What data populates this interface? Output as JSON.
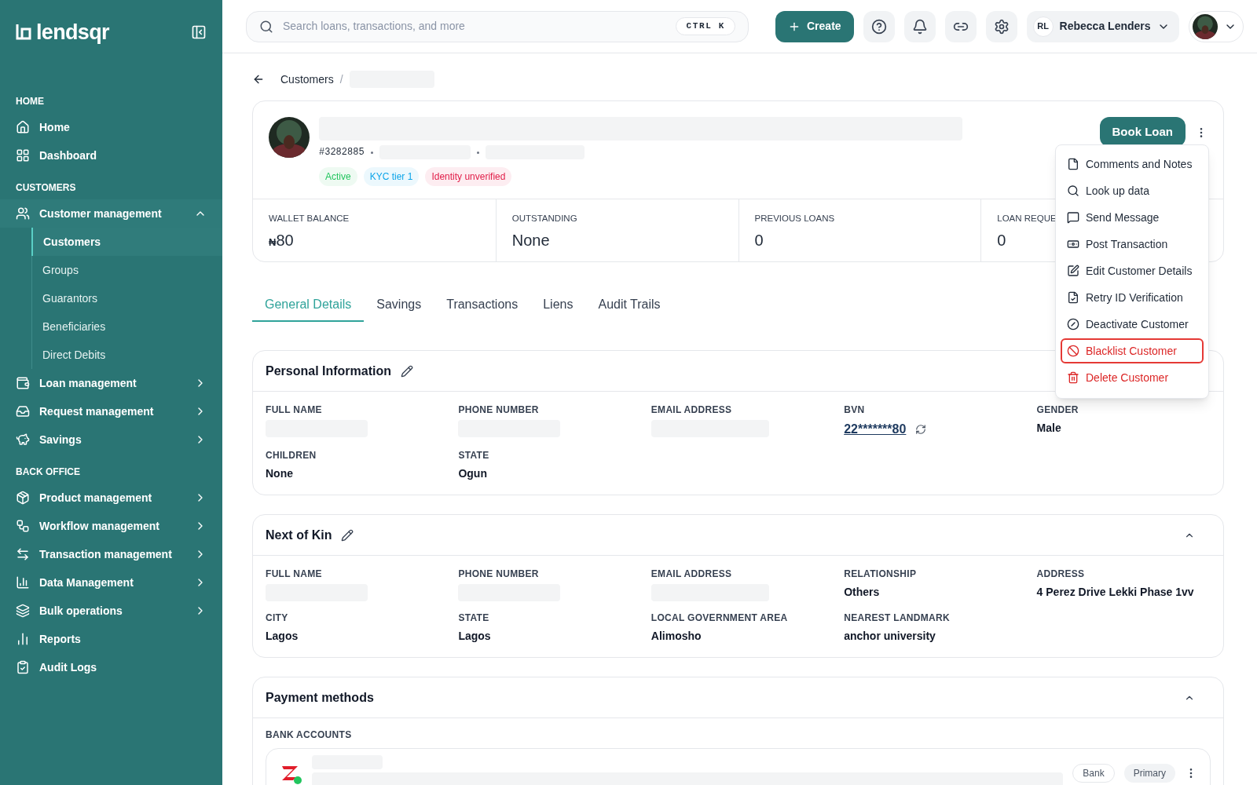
{
  "brand": {
    "name": "lendsqr"
  },
  "sidebar": {
    "sections": [
      {
        "title": "HOME",
        "items": [
          {
            "label": "Home",
            "kind": "link",
            "selected": false
          },
          {
            "label": "Dashboard",
            "kind": "link",
            "selected": false
          }
        ]
      },
      {
        "title": "CUSTOMERS",
        "items": [
          {
            "label": "Customer management",
            "kind": "group",
            "expanded": true,
            "selected": false,
            "children": [
              {
                "label": "Customers",
                "selected": true
              },
              {
                "label": "Groups",
                "selected": false
              },
              {
                "label": "Guarantors",
                "selected": false
              },
              {
                "label": "Beneficiaries",
                "selected": false
              },
              {
                "label": "Direct Debits",
                "selected": false
              }
            ]
          },
          {
            "label": "Loan management",
            "kind": "group",
            "expanded": false,
            "selected": false
          },
          {
            "label": "Request management",
            "kind": "group",
            "expanded": false,
            "selected": false
          },
          {
            "label": "Savings",
            "kind": "group",
            "expanded": false,
            "selected": false
          }
        ]
      },
      {
        "title": "BACK OFFICE",
        "items": [
          {
            "label": "Product management",
            "kind": "group",
            "expanded": false,
            "selected": false
          },
          {
            "label": "Workflow management",
            "kind": "group",
            "expanded": false,
            "selected": false
          },
          {
            "label": "Transaction management",
            "kind": "group",
            "expanded": false,
            "selected": false
          },
          {
            "label": "Data Management",
            "kind": "group",
            "expanded": false,
            "selected": false
          },
          {
            "label": "Bulk operations",
            "kind": "group",
            "expanded": false,
            "selected": false
          },
          {
            "label": "Reports",
            "kind": "link",
            "selected": false
          },
          {
            "label": "Audit Logs",
            "kind": "link",
            "selected": false
          }
        ]
      }
    ]
  },
  "header": {
    "search": {
      "placeholder": "Search loans, transactions, and more",
      "shortcut": "CTRL K"
    },
    "create_button": "Create",
    "user": {
      "initials": "RL",
      "name": "Rebecca Lenders"
    }
  },
  "breadcrumb": [
    "Customers",
    "/"
  ],
  "profile": {
    "customer_id": "#3282885",
    "badges": [
      {
        "label": "Active",
        "color": "#22c55e"
      },
      {
        "label": "KYC tier 1",
        "color": "#0ea5e9"
      },
      {
        "label": "Identity unverified",
        "color": "#e11d48"
      }
    ],
    "book_loan": "Book Loan"
  },
  "stats": [
    {
      "label": "WALLET BALANCE",
      "currency": "₦",
      "value": "80"
    },
    {
      "label": "OUTSTANDING",
      "value": "None"
    },
    {
      "label": "PREVIOUS LOANS",
      "value": "0"
    },
    {
      "label": "LOAN REQUE",
      "value": "0"
    }
  ],
  "menu": [
    {
      "label": "Comments and Notes",
      "kind": "normal",
      "selected": false
    },
    {
      "label": "Look up data",
      "kind": "normal",
      "selected": false
    },
    {
      "label": "Send Message",
      "kind": "normal",
      "selected": false
    },
    {
      "label": "Post Transaction",
      "kind": "normal",
      "selected": false
    },
    {
      "label": "Edit Customer Details",
      "kind": "normal",
      "selected": false
    },
    {
      "label": "Retry ID Verification",
      "kind": "normal",
      "selected": false
    },
    {
      "label": "Deactivate Customer",
      "kind": "normal",
      "selected": false
    },
    {
      "label": "Blacklist Customer",
      "kind": "danger",
      "selected": true
    },
    {
      "label": "Delete Customer",
      "kind": "danger",
      "selected": false
    }
  ],
  "tabs": [
    {
      "label": "General Details",
      "selected": true
    },
    {
      "label": "Savings",
      "selected": false
    },
    {
      "label": "Transactions",
      "selected": false
    },
    {
      "label": "Liens",
      "selected": false
    },
    {
      "label": "Audit Trails",
      "selected": false
    }
  ],
  "personal_information": {
    "title": "Personal Information",
    "fields": [
      {
        "label": "FULL NAME",
        "kind": "hidden"
      },
      {
        "label": "PHONE NUMBER",
        "kind": "hidden"
      },
      {
        "label": "EMAIL ADDRESS",
        "kind": "hidden"
      },
      {
        "label": "BVN",
        "kind": "link",
        "value": "22*******80"
      },
      {
        "label": "GENDER",
        "kind": "text",
        "value": "Male"
      },
      {
        "label": "CHILDREN",
        "kind": "text",
        "value": "None"
      },
      {
        "label": "STATE",
        "kind": "text",
        "value": "Ogun"
      }
    ]
  },
  "next_of_kin": {
    "title": "Next of Kin",
    "expanded": true,
    "fields": [
      {
        "label": "FULL NAME",
        "kind": "hidden"
      },
      {
        "label": "PHONE NUMBER",
        "kind": "hidden"
      },
      {
        "label": "EMAIL ADDRESS",
        "kind": "hidden"
      },
      {
        "label": "RELATIONSHIP",
        "kind": "text",
        "value": "Others"
      },
      {
        "label": "ADDRESS",
        "kind": "text",
        "value": "4 Perez Drive Lekki Phase 1vv"
      },
      {
        "label": "CITY",
        "kind": "text",
        "value": "Lagos"
      },
      {
        "label": "STATE",
        "kind": "text",
        "value": "Lagos"
      },
      {
        "label": "LOCAL GOVERNMENT AREA",
        "kind": "text",
        "value": "Alimosho"
      },
      {
        "label": "NEAREST LANDMARK",
        "kind": "text",
        "value": "anchor university"
      }
    ]
  },
  "payment_methods": {
    "title": "Payment methods",
    "expanded": true,
    "subtitle": "BANK ACCOUNTS",
    "accounts": [
      {
        "tags": [
          "Bank",
          "Primary"
        ]
      }
    ]
  }
}
